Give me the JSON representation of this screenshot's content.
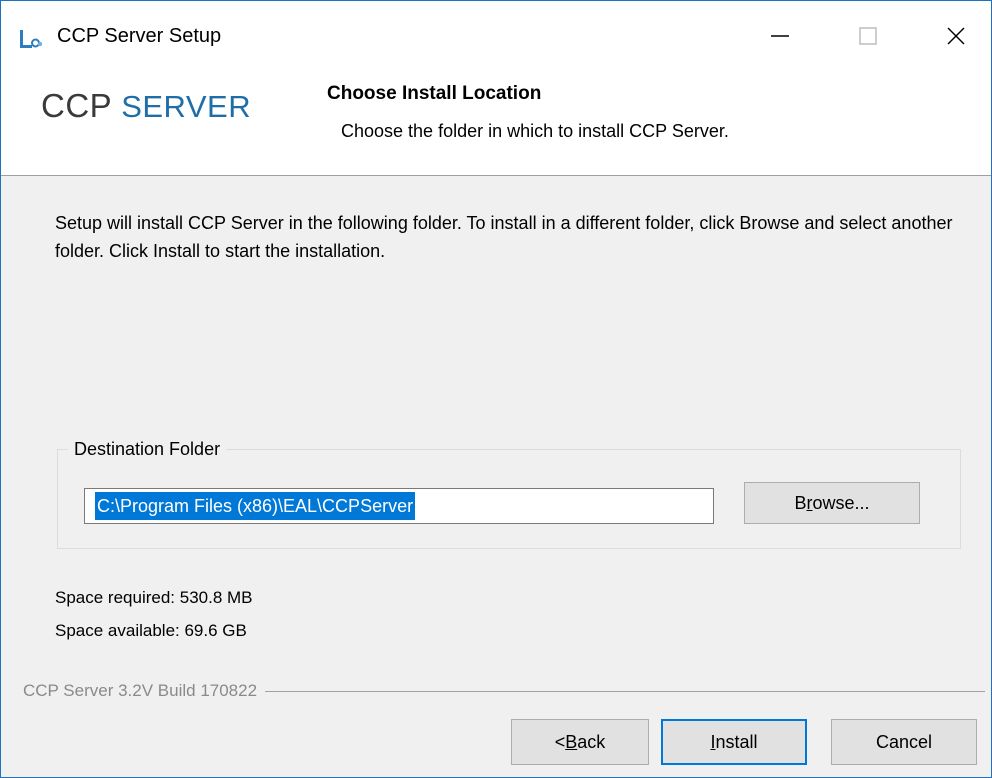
{
  "window": {
    "title": "CCP Server Setup",
    "controls": {
      "minimize": "minimize",
      "maximize": "maximize",
      "close": "close"
    }
  },
  "header": {
    "logo_part1": "CCP",
    "logo_part2": "SERVER",
    "title": "Choose Install Location",
    "subtitle": "Choose the folder in which to install CCP Server."
  },
  "body": {
    "intro": "Setup will install CCP Server in the following folder. To install in a different folder, click Browse and select another folder. Click Install to start the installation."
  },
  "destination": {
    "group_label": "Destination Folder",
    "path": "C:\\Program Files (x86)\\EAL\\CCPServer",
    "browse_pre": "B",
    "browse_ul": "r",
    "browse_post": "owse..."
  },
  "space": {
    "required": "Space required: 530.8 MB",
    "available": "Space available: 69.6 GB"
  },
  "footer": {
    "branding": "CCP Server 3.2V Build 170822",
    "back_pre": "< ",
    "back_ul": "B",
    "back_post": "ack",
    "install_ul": "I",
    "install_post": "nstall",
    "cancel": "Cancel"
  },
  "colors": {
    "accent": "#0078d7",
    "logo_blue": "#1f6ea8",
    "dialog_bg": "#f0f0f0"
  }
}
